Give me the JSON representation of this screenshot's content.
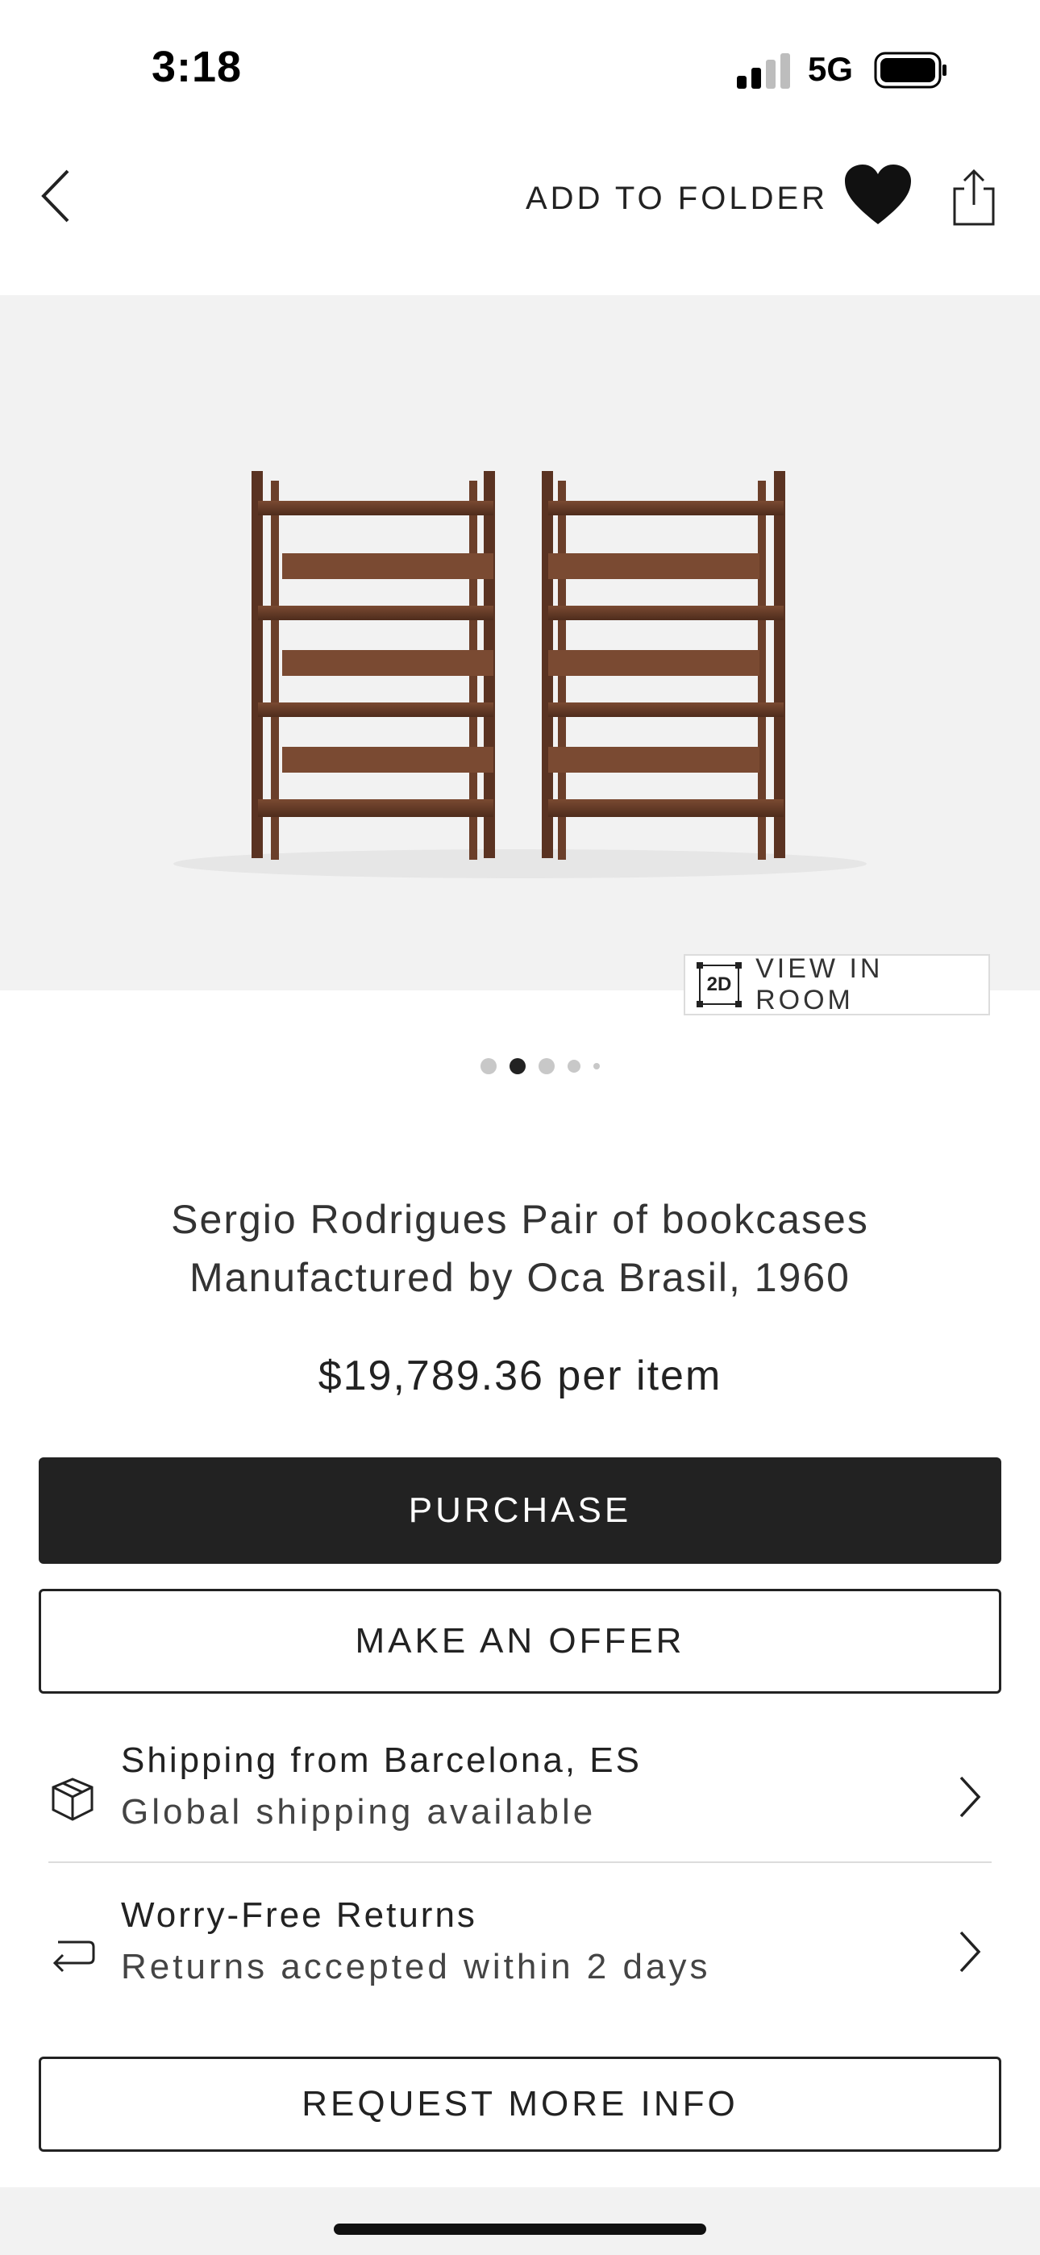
{
  "status_bar": {
    "time": "3:18",
    "network": "5G"
  },
  "header": {
    "add_to_folder": "ADD TO FOLDER"
  },
  "hero": {
    "view_in_room_badge": "2D",
    "view_in_room_label": "VIEW IN ROOM"
  },
  "carousel": {
    "total": 5,
    "active_index": 1
  },
  "product": {
    "title_line1": "Sergio Rodrigues Pair of bookcases",
    "title_line2": "Manufactured by Oca Brasil, 1960",
    "price": "$19,789.36 per item"
  },
  "actions": {
    "purchase": "PURCHASE",
    "make_offer": "MAKE AN OFFER",
    "request_info": "REQUEST MORE INFO"
  },
  "details": [
    {
      "title": "Shipping from Barcelona, ES",
      "subtitle": "Global shipping available",
      "icon": "box-icon"
    },
    {
      "title": "Worry-Free Returns",
      "subtitle": "Returns accepted within 2 days",
      "icon": "return-arrow-icon"
    }
  ],
  "colors": {
    "primary": "#222222",
    "hero_bg": "#f2f2f2",
    "wood": "#6b3f2a"
  }
}
